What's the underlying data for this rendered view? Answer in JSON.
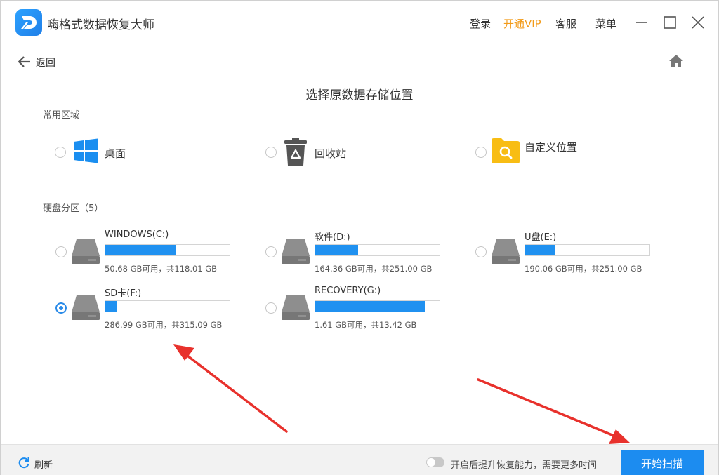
{
  "app": {
    "title": "嗨格式数据恢复大师"
  },
  "top_links": {
    "login": "登录",
    "vip": "开通VIP",
    "service": "客服",
    "menu": "菜单"
  },
  "nav": {
    "back_label": "返回"
  },
  "page": {
    "title": "选择原数据存储位置"
  },
  "common_areas": {
    "label": "常用区域",
    "items": [
      {
        "label": "桌面",
        "icon": "windows-icon",
        "selected": false
      },
      {
        "label": "回收站",
        "icon": "recycle-bin-icon",
        "selected": false
      },
      {
        "label": "自定义位置",
        "icon": "folder-search-icon",
        "selected": false
      }
    ]
  },
  "partitions": {
    "label": "硬盘分区（5）",
    "items": [
      {
        "name": "WINDOWS(C:)",
        "info": "50.68 GB可用，共118.01 GB",
        "used_fraction": 0.571,
        "selected": false
      },
      {
        "name": "软件(D:)",
        "info": "164.36 GB可用，共251.00 GB",
        "used_fraction": 0.345,
        "selected": false
      },
      {
        "name": "U盘(E:)",
        "info": "190.06 GB可用，共251.00 GB",
        "used_fraction": 0.243,
        "selected": false
      },
      {
        "name": "SD卡(F:)",
        "info": "286.99 GB可用，共315.09 GB",
        "used_fraction": 0.089,
        "selected": true
      },
      {
        "name": "RECOVERY(G:)",
        "info": "1.61 GB可用，共13.42 GB",
        "used_fraction": 0.88,
        "selected": false
      }
    ]
  },
  "bottom": {
    "refresh_label": "刷新",
    "toggle_label": "开启后提升恢复能力，需要更多时间",
    "toggle_on": false,
    "scan_label": "开始扫描"
  },
  "colors": {
    "accent": "#1c8cf0",
    "vip": "#f29b1a",
    "annotation_arrow": "#e8312c"
  }
}
